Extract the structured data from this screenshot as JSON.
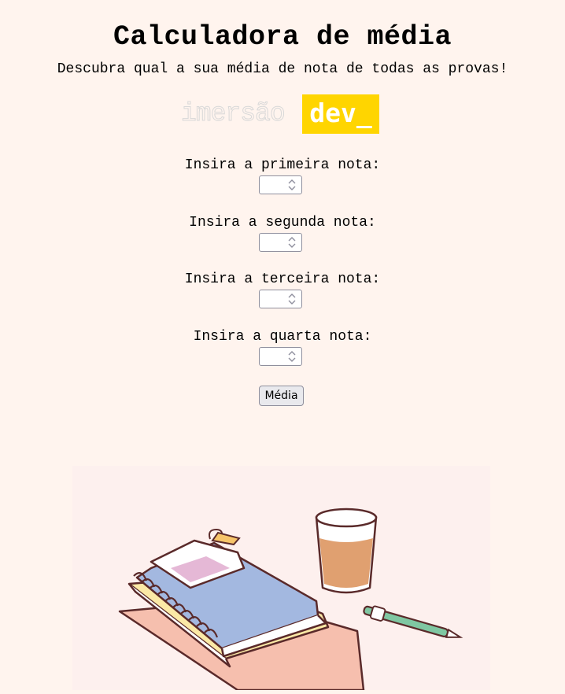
{
  "header": {
    "title": "Calculadora de média",
    "subtitle": "Descubra qual a sua média de nota de todas as provas!"
  },
  "logo": {
    "left_text": "imersão",
    "right_text": "dev_",
    "accent_color": "#ffd500"
  },
  "form": {
    "fields": [
      {
        "label": "Insira a primeira nota:",
        "value": ""
      },
      {
        "label": "Insira a segunda nota:",
        "value": ""
      },
      {
        "label": "Insira a terceira nota:",
        "value": ""
      },
      {
        "label": "Insira a quarta nota:",
        "value": ""
      }
    ],
    "submit_label": "Média"
  },
  "colors": {
    "background": "#fff4ee"
  },
  "illustration": {
    "icon": "notebooks-glass-pen-illustration"
  }
}
